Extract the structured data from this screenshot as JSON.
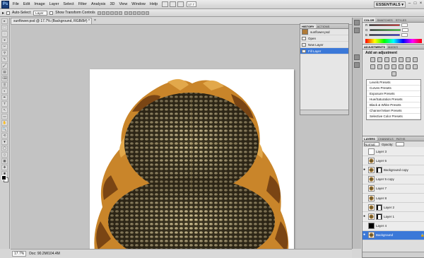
{
  "app": {
    "logo": "Ps",
    "menus": [
      "File",
      "Edit",
      "Image",
      "Layer",
      "Select",
      "Filter",
      "Analysis",
      "3D",
      "View",
      "Window",
      "Help"
    ],
    "zoom_field": "17.7",
    "workspace": "ESSENTIALS ▾",
    "window_buttons": [
      "–",
      "□",
      "×"
    ]
  },
  "options_bar": {
    "auto_select_label": "Auto-Select:",
    "auto_select_value": "Layer",
    "transform_label": "Show Transform Controls"
  },
  "toolbox": {
    "tools": [
      "▸",
      "⬚",
      "◌",
      "⌖",
      "✂",
      "⚲",
      "✎",
      "🖌",
      "▤",
      "⌫",
      "▒",
      "◐",
      "✒",
      "T",
      "↖",
      "▭",
      "✋",
      "🔍",
      "⟲",
      "▼",
      "◯",
      "▯",
      "▦",
      "❖",
      "✱"
    ]
  },
  "document": {
    "tab_title": "sunflower.psd @ 17.7% (Background, RGB/8#) *",
    "tab_close": "×",
    "status_zoom": "17.7%",
    "status_doc": "Doc: 90.2M/104.4M",
    "artwork_colors": {
      "seeds_dark": "#3d3622",
      "seeds_light": "#b9a879",
      "petals": "#c9852a",
      "petals_dark": "#7a4514"
    }
  },
  "history": {
    "tabs": [
      "HISTORY",
      "ACTIONS"
    ],
    "snapshot": "sunflower.psd",
    "items": [
      "Open",
      "New Layer",
      "Fill Layer"
    ],
    "selected_index": 2
  },
  "color_panel": {
    "tabs": [
      "COLOR",
      "SWATCHES",
      "STYLES"
    ],
    "channels": [
      {
        "label": "R",
        "gradient": "linear-gradient(90deg,#000,#f00)"
      },
      {
        "label": "G",
        "gradient": "linear-gradient(90deg,#000,#0f0)"
      },
      {
        "label": "B",
        "gradient": "linear-gradient(90deg,#000,#00f)"
      }
    ]
  },
  "adjustments": {
    "tabs": [
      "ADJUSTMENTS",
      "MASKS"
    ],
    "title": "Add an adjustment",
    "icon_count": 15,
    "presets": [
      "Levels Presets",
      "Curves Presets",
      "Exposure Presets",
      "Hue/Saturation Presets",
      "Black & White Presets",
      "Channel Mixer Presets",
      "Selective Color Presets"
    ]
  },
  "layers": {
    "tabs": [
      "LAYERS",
      "CHANNELS",
      "PATHS"
    ],
    "blend_mode": "Normal",
    "opacity_label": "Opacity:",
    "rows": [
      {
        "name": "Layer 3",
        "thumb": "blank",
        "visible": false
      },
      {
        "name": "Layer 6",
        "thumb": "img",
        "visible": false
      },
      {
        "name": "Background copy",
        "thumb": "img",
        "mask": true,
        "visible": true
      },
      {
        "name": "Layer 5 copy",
        "thumb": "img",
        "visible": false
      },
      {
        "name": "Layer 7",
        "thumb": "img",
        "visible": false
      },
      {
        "name": "Layer 8",
        "thumb": "img",
        "visible": false
      },
      {
        "name": "Layer 2",
        "thumb": "img",
        "mask": true,
        "visible": false
      },
      {
        "name": "Layer 1",
        "thumb": "img",
        "mask": true,
        "visible": true
      },
      {
        "name": "Layer 4",
        "thumb": "black",
        "visible": false
      },
      {
        "name": "Background",
        "thumb": "img",
        "visible": true,
        "selected": true,
        "lock": "🔒"
      }
    ]
  }
}
